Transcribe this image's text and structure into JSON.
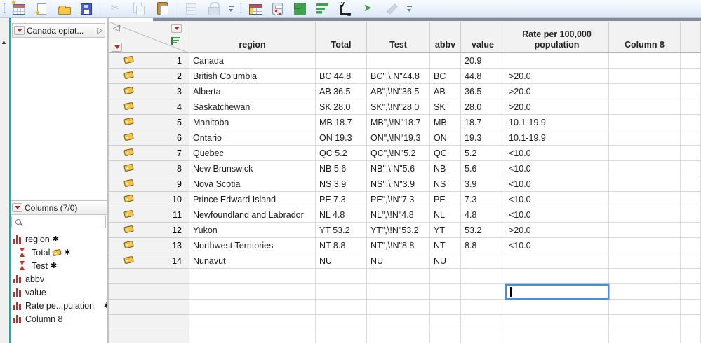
{
  "icons": {
    "asterisk": "✱",
    "disclosure": "▷",
    "corner_collapse": "◁",
    "dock_collapse": "▲",
    "cut": "✂",
    "join": "➤"
  },
  "colors": {
    "accent_teal": "#12adb5",
    "selection_blue": "#4a8edb",
    "triangle_red": "#cf2721",
    "nominal_icon_red": "#c23128",
    "tag_yellow": "#f7c442",
    "bars_green": "#3fa34d"
  },
  "toolbar": {
    "group1": [
      {
        "cls": "grip",
        "name": "toolbar-grip"
      },
      {
        "cls": "i-new-table",
        "name": "new-data-table-icon"
      },
      {
        "cls": "i-new-script",
        "name": "new-script-icon"
      },
      {
        "cls": "i-open",
        "name": "open-file-icon"
      },
      {
        "cls": "i-save",
        "name": "save-icon"
      },
      {
        "cls": "sep",
        "name": "toolbar-separator"
      },
      {
        "cls": "i-cut dis",
        "name": "cut-icon",
        "glyph": "cut"
      },
      {
        "cls": "i-copy dis",
        "name": "copy-icon"
      },
      {
        "cls": "i-paste",
        "name": "paste-icon"
      },
      {
        "cls": "sep",
        "name": "toolbar-separator"
      },
      {
        "cls": "i-props dis",
        "name": "properties-icon"
      },
      {
        "cls": "i-lock dis",
        "name": "lock-icon"
      },
      {
        "cls": "ovf",
        "name": "toolbar-overflow-button"
      }
    ],
    "group2": [
      {
        "cls": "grip",
        "name": "toolbar-grip"
      },
      {
        "cls": "i-table2",
        "name": "data-table-icon"
      },
      {
        "cls": "i-calc",
        "name": "calculator-icon"
      },
      {
        "cls": "i-quad",
        "name": "tile-windows-icon"
      },
      {
        "cls": "i-hbars",
        "name": "graph-bars-icon"
      },
      {
        "cls": "i-yx",
        "name": "fit-y-by-x-icon"
      },
      {
        "cls": "i-join",
        "name": "join-tables-icon",
        "glyph": "join"
      },
      {
        "cls": "i-edit dis",
        "name": "edit-icon"
      },
      {
        "cls": "ovf",
        "name": "toolbar-overflow-button"
      }
    ]
  },
  "side_panel": {
    "table_panel": {
      "title": "Canada opiat..."
    },
    "columns_panel": {
      "title": "Columns (7/0)",
      "search_value": "",
      "items": [
        {
          "label": "region",
          "icon": "nominal",
          "asterisk": true
        },
        {
          "label": "Total",
          "icon": "character",
          "tag": true,
          "asterisk": true,
          "indent": true
        },
        {
          "label": "Test",
          "icon": "character",
          "asterisk": true,
          "indent": true
        },
        {
          "label": "abbv",
          "icon": "nominal"
        },
        {
          "label": "value",
          "icon": "nominal"
        },
        {
          "label": "Rate pe...pulation",
          "icon": "nominal",
          "asterisk": true,
          "clipped": true
        },
        {
          "label": "Column 8",
          "icon": "nominal"
        }
      ]
    }
  },
  "grid": {
    "columns": [
      "region",
      "Total",
      "Test",
      "abbv",
      "value",
      "Rate per 100,000 population",
      "Column 8"
    ],
    "rows": [
      {
        "num": "1",
        "cells": [
          "Canada",
          "",
          "",
          "",
          "20.9",
          ""
        ]
      },
      {
        "num": "2",
        "cells": [
          "British Columbia",
          "BC 44.8",
          "BC\",\\!N\"44.8",
          "BC",
          "44.8",
          ">20.0"
        ]
      },
      {
        "num": "3",
        "cells": [
          "Alberta",
          "AB 36.5",
          "AB\",\\!N\"36.5",
          "AB",
          "36.5",
          ">20.0"
        ]
      },
      {
        "num": "4",
        "cells": [
          "Saskatchewan",
          "SK 28.0",
          "SK\",\\!N\"28.0",
          "SK",
          "28.0",
          ">20.0"
        ]
      },
      {
        "num": "5",
        "cells": [
          "Manitoba",
          "MB 18.7",
          "MB\",\\!N\"18.7",
          "MB",
          "18.7",
          "10.1-19.9"
        ]
      },
      {
        "num": "6",
        "cells": [
          "Ontario",
          "ON 19.3",
          "ON\",\\!N\"19.3",
          "ON",
          "19.3",
          "10.1-19.9"
        ]
      },
      {
        "num": "7",
        "cells": [
          "Quebec",
          "QC 5.2",
          "QC\",\\!N\"5.2",
          "QC",
          "5.2",
          "<10.0"
        ]
      },
      {
        "num": "8",
        "cells": [
          "New Brunswick",
          "NB 5.6",
          "NB\",\\!N\"5.6",
          "NB",
          "5.6",
          "<10.0"
        ]
      },
      {
        "num": "9",
        "cells": [
          "Nova Scotia",
          "NS 3.9",
          "NS\",\\!N\"3.9",
          "NS",
          "3.9",
          "<10.0"
        ]
      },
      {
        "num": "10",
        "cells": [
          "Prince Edward Island",
          "PE 7.3",
          "PE\",\\!N\"7.3",
          "PE",
          "7.3",
          "<10.0"
        ]
      },
      {
        "num": "11",
        "cells": [
          "Newfoundland and Labrador",
          "NL 4.8",
          "NL\",\\!N\"4.8",
          "NL",
          "4.8",
          "<10.0"
        ]
      },
      {
        "num": "12",
        "cells": [
          "Yukon",
          "YT 53.2",
          "YT\",\\!N\"53.2",
          "YT",
          "53.2",
          ">20.0"
        ]
      },
      {
        "num": "13",
        "cells": [
          "Northwest Territories",
          "NT 8.8",
          "NT\",\\!N\"8.8",
          "NT",
          "8.8",
          "<10.0"
        ]
      },
      {
        "num": "14",
        "cells": [
          "Nunavut",
          "NU",
          "NU",
          "NU",
          "",
          ""
        ]
      }
    ],
    "empty_row_count": 5,
    "selected_cell": {
      "row": 16,
      "column": "Rate per 100,000 population",
      "value": ""
    }
  }
}
